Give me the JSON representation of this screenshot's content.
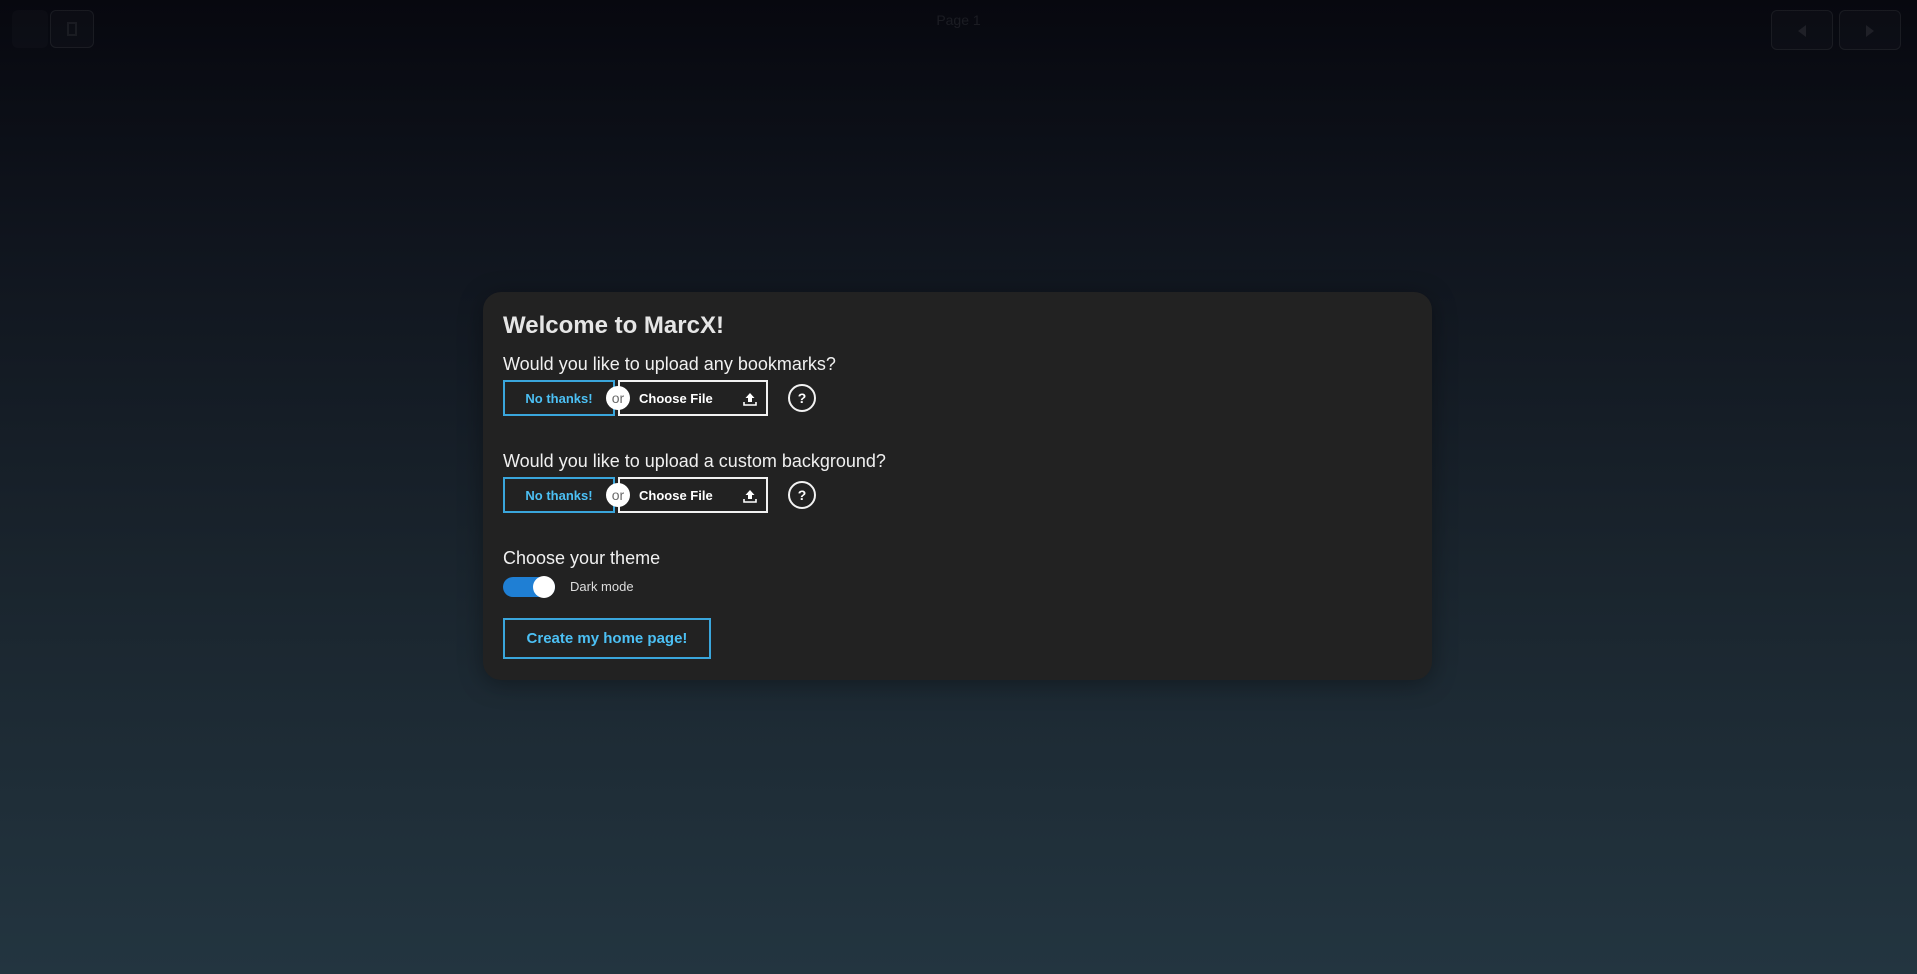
{
  "topbar": {
    "title": "Page 1"
  },
  "card": {
    "title": "Welcome to MarcX!",
    "bookmarks": {
      "question": "Would you like to upload any bookmarks?",
      "no_thanks_label": "No thanks!",
      "or_label": "or",
      "choose_file_label": "Choose File",
      "help_label": "?"
    },
    "background": {
      "question": "Would you like to upload a custom background?",
      "no_thanks_label": "No thanks!",
      "or_label": "or",
      "choose_file_label": "Choose File",
      "help_label": "?"
    },
    "theme": {
      "heading": "Choose your theme",
      "toggle_label": "Dark mode",
      "dark_mode_enabled": true
    },
    "create_button_label": "Create my home page!"
  },
  "colors": {
    "accent": "#3aa6dc",
    "accent_text": "#4cc0f4",
    "toggle_on": "#1f7fd4",
    "card_bg": "#222222"
  },
  "icons": {
    "upload": "upload-icon",
    "help": "question-icon",
    "nav_prev": "arrow-left-icon",
    "nav_next": "arrow-right-icon"
  }
}
